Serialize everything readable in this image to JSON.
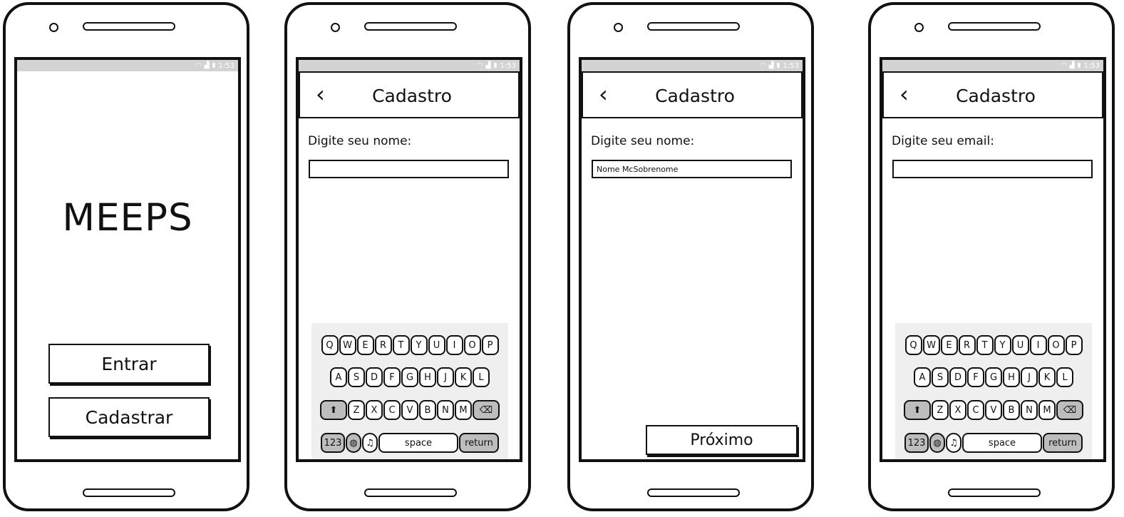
{
  "status_bar": {
    "time": "1:53",
    "wifi_icon": "wifi-icon",
    "signal_icon": "signal-icon",
    "battery_icon": "battery-icon"
  },
  "screen_home": {
    "logo": "MEEPS",
    "login_label": "Entrar",
    "register_label": "Cadastrar"
  },
  "screen_name_empty": {
    "title": "Cadastro",
    "field_label": "Digite seu nome:",
    "field_value": ""
  },
  "screen_name_filled": {
    "title": "Cadastro",
    "field_label": "Digite seu nome:",
    "field_value": "Nome McSobrenome",
    "next_label": "Próximo"
  },
  "screen_email": {
    "title": "Cadastro",
    "field_label": "Digite seu email:",
    "field_value": ""
  },
  "keyboard": {
    "row1": [
      "Q",
      "W",
      "E",
      "R",
      "T",
      "Y",
      "U",
      "I",
      "O",
      "P"
    ],
    "row2": [
      "A",
      "S",
      "D",
      "F",
      "G",
      "H",
      "J",
      "K",
      "L"
    ],
    "row3": [
      "Z",
      "X",
      "C",
      "V",
      "B",
      "N",
      "M"
    ],
    "shift_icon": "shift-arrow-icon",
    "backspace_icon": "backspace-icon",
    "globe_icon": "globe-icon",
    "mic_icon": "microphone-icon",
    "numbers_label": "123",
    "space_label": "space",
    "return_label": "return"
  }
}
